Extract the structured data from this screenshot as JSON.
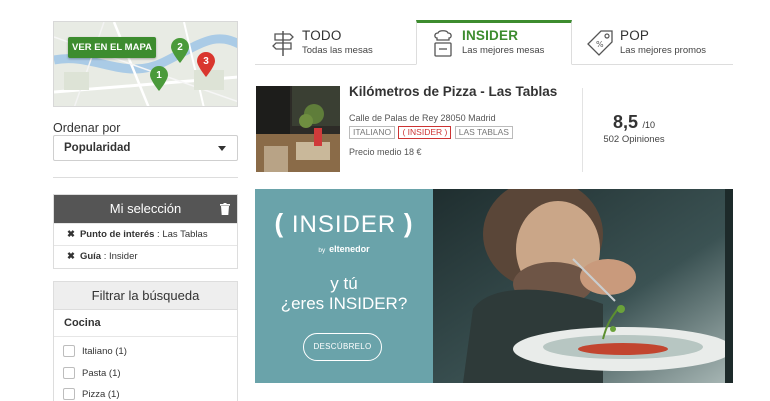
{
  "map": {
    "button_label": "VER EN EL MAPA",
    "pins": [
      "1",
      "2",
      "3"
    ]
  },
  "sort": {
    "label": "Ordenar por",
    "selected": "Popularidad"
  },
  "selection": {
    "title": "Mi selección",
    "items": [
      {
        "key": "Punto de interés",
        "value": ": Las Tablas"
      },
      {
        "key": "Guía",
        "value": ": Insider"
      }
    ]
  },
  "filters": {
    "title": "Filtrar la búsqueda",
    "section": "Cocina",
    "options": [
      "Italiano (1)",
      "Pasta (1)",
      "Pizza (1)"
    ]
  },
  "tabs": [
    {
      "title": "TODO",
      "subtitle": "Todas las mesas",
      "icon": "signpost-icon"
    },
    {
      "title": "INSIDER",
      "subtitle": "Las mejores mesas",
      "icon": "chef-icon"
    },
    {
      "title": "POP",
      "subtitle": "Las mejores promos",
      "icon": "price-tag-icon"
    }
  ],
  "restaurant": {
    "name": "Kilómetros de Pizza - Las Tablas",
    "address": "Calle de Palas de Rey 28050 Madrid",
    "tags": [
      "ITALIANO",
      "( INSIDER )",
      "LAS TABLAS"
    ],
    "price": "Precio medio 18 €",
    "score": "8,5",
    "score_of": "/10",
    "opinions": "502 Opiniones"
  },
  "banner": {
    "open": "(",
    "title": "INSIDER",
    "close": ")",
    "by": "by",
    "brand": "eltenedor",
    "question_line1": "y tú",
    "question_line2": "¿eres INSIDER?",
    "cta": "DESCÚBRELO"
  },
  "colors": {
    "accent": "#3d8c2f",
    "tag_red": "#cc3333",
    "banner_teal": "#6aa3aa",
    "header_dark": "#555555"
  }
}
